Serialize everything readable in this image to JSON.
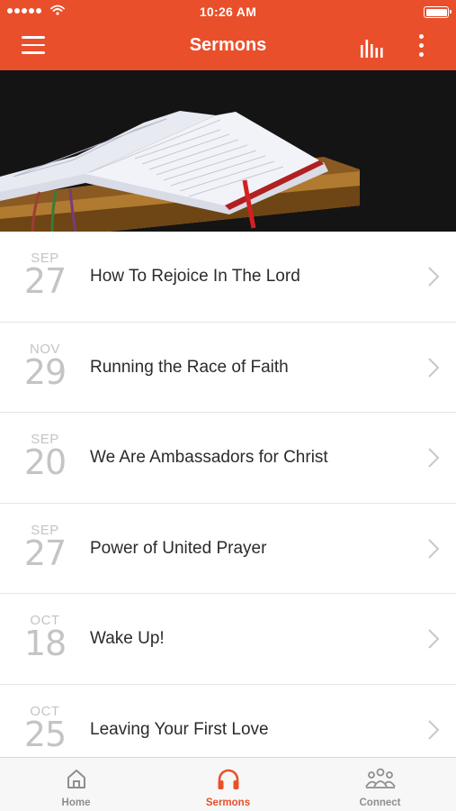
{
  "status_bar": {
    "time": "10:26 AM",
    "signal_icon": "signal-dots-icon",
    "wifi_icon": "wifi-icon",
    "battery_icon": "battery-icon"
  },
  "nav": {
    "title": "Sermons",
    "menu_icon": "hamburger-menu-icon",
    "audio_icon": "audio-levels-icon",
    "more_icon": "more-vertical-icon"
  },
  "theme": {
    "accent": "#ea4f2b",
    "date_color": "#c4c4c4",
    "inactive_tab": "#8e8e8e"
  },
  "sermons": [
    {
      "month": "SEP",
      "day": "27",
      "title": "How To Rejoice In The Lord"
    },
    {
      "month": "NOV",
      "day": "29",
      "title": "Running the Race of Faith"
    },
    {
      "month": "SEP",
      "day": "20",
      "title": "We Are Ambassadors for Christ"
    },
    {
      "month": "SEP",
      "day": "27",
      "title": "Power of United Prayer"
    },
    {
      "month": "OCT",
      "day": "18",
      "title": "Wake Up!"
    },
    {
      "month": "OCT",
      "day": "25",
      "title": "Leaving Your First Love"
    }
  ],
  "tabs": [
    {
      "label": "Home",
      "icon": "home-icon",
      "active": false
    },
    {
      "label": "Sermons",
      "icon": "headphones-icon",
      "active": true
    },
    {
      "label": "Connect",
      "icon": "people-group-icon",
      "active": false
    }
  ]
}
